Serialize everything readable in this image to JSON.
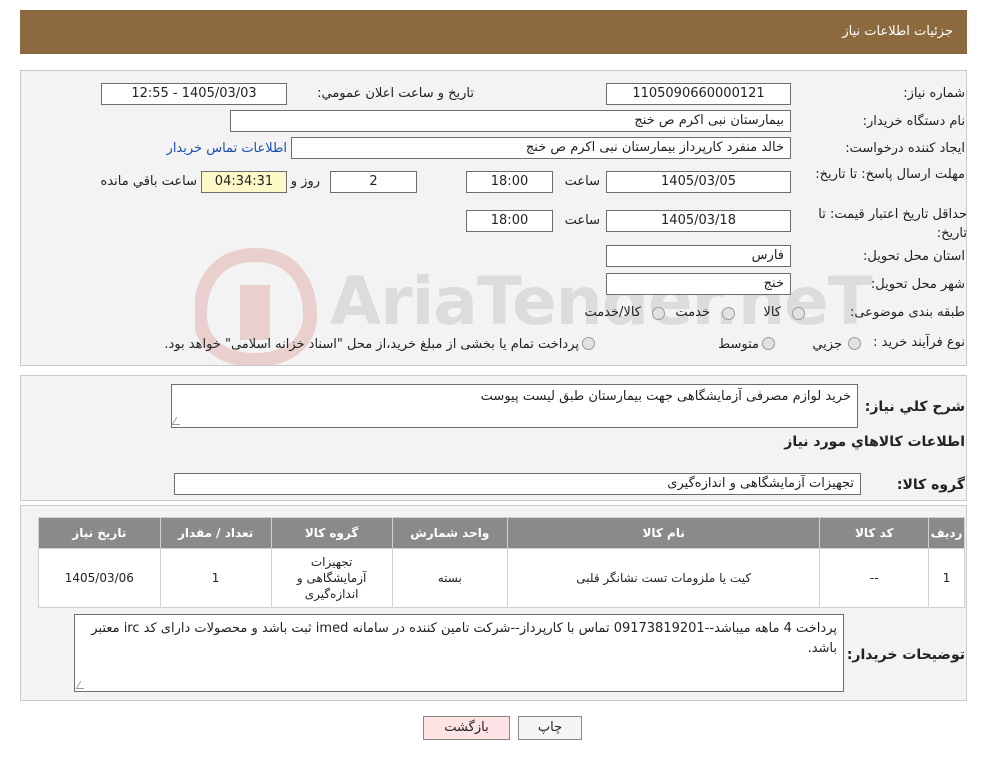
{
  "header": {
    "title": "جزئیات اطلاعات نیاز"
  },
  "form": {
    "need_number_label": "شماره نیاز:",
    "need_number": "1105090660000121",
    "announce_label": "تاریخ و ساعت اعلان عمومي:",
    "announce_value": "1405/03/03 - 12:55",
    "buyer_org_label": "نام دستگاه خريدار:",
    "buyer_org": "بيمارستان نبی اکرم  ص  خنج",
    "creator_label": "ايجاد كننده درخواست:",
    "creator": "خالد منفرد کارپرداز بيمارستان نبی اکرم  ص  خنج",
    "contact_link": "اطلاعات تماس خريدار",
    "deadline_label": "مهلت ارسال پاسخ: تا تاريخ:",
    "deadline_date": "1405/03/05",
    "time_label": "ساعت",
    "deadline_time": "18:00",
    "days": "2",
    "days_label": "روز و",
    "remaining": "04:34:31",
    "remaining_label": "ساعت باقي مانده",
    "validity_label": "حداقل تاريخ اعتبار قيمت: تا تاريخ:",
    "validity_date": "1405/03/18",
    "validity_time": "18:00",
    "province_label": "استان محل تحويل:",
    "province": "فارس",
    "city_label": "شهر محل تحويل:",
    "city": "خنج",
    "category_label": "طبقه بندی موضوعی:",
    "category_options": [
      "كالا",
      "خدمت",
      "كالا/خدمت"
    ],
    "process_label": "نوع فرآيند خريد :",
    "process_options": [
      "جزيي",
      "متوسط"
    ],
    "process_note": "پرداخت تمام يا بخشی از مبلغ خريد،از محل \"اسناد خزانه اسلامی\" خواهد بود."
  },
  "description": {
    "label": "شرح كلي نياز:",
    "value": "خريد لوازم مصرفی  آزمايشگاهی  جهت بيمارستان طبق ليست پيوست"
  },
  "goods_section": {
    "title": "اطلاعات كالاهاي مورد نياز"
  },
  "goods_group": {
    "label": "گروه كالا:",
    "value": "تجهيزات آزمايشگاهی و اندازه‌گيری"
  },
  "table": {
    "headers": [
      "رديف",
      "كد كالا",
      "نام كالا",
      "واحد شمارش",
      "گروه كالا",
      "تعداد / مقدار",
      "تاريخ نياز"
    ],
    "rows": [
      {
        "row": "1",
        "code": "--",
        "name": "کيت يا ملزومات تست نشانگر قلبی",
        "unit": "بسته",
        "group": "تجهيزات آزمايشگاهی و اندازه‌گيری",
        "qty": "1",
        "date": "1405/03/06"
      }
    ]
  },
  "buyer_notes": {
    "label": "توضيحات خريدار:",
    "value": "پرداخت 4 ماهه ميباشد--09173819201 تماس با کارپرداز--شرکت تامين کننده در سامانه imed  ثبت باشد و محصولات دارای کد irc  معتبر باشد."
  },
  "buttons": {
    "print": "چاپ",
    "back": "بازگشت"
  },
  "watermark": {
    "text": "AriaTender.neT"
  }
}
